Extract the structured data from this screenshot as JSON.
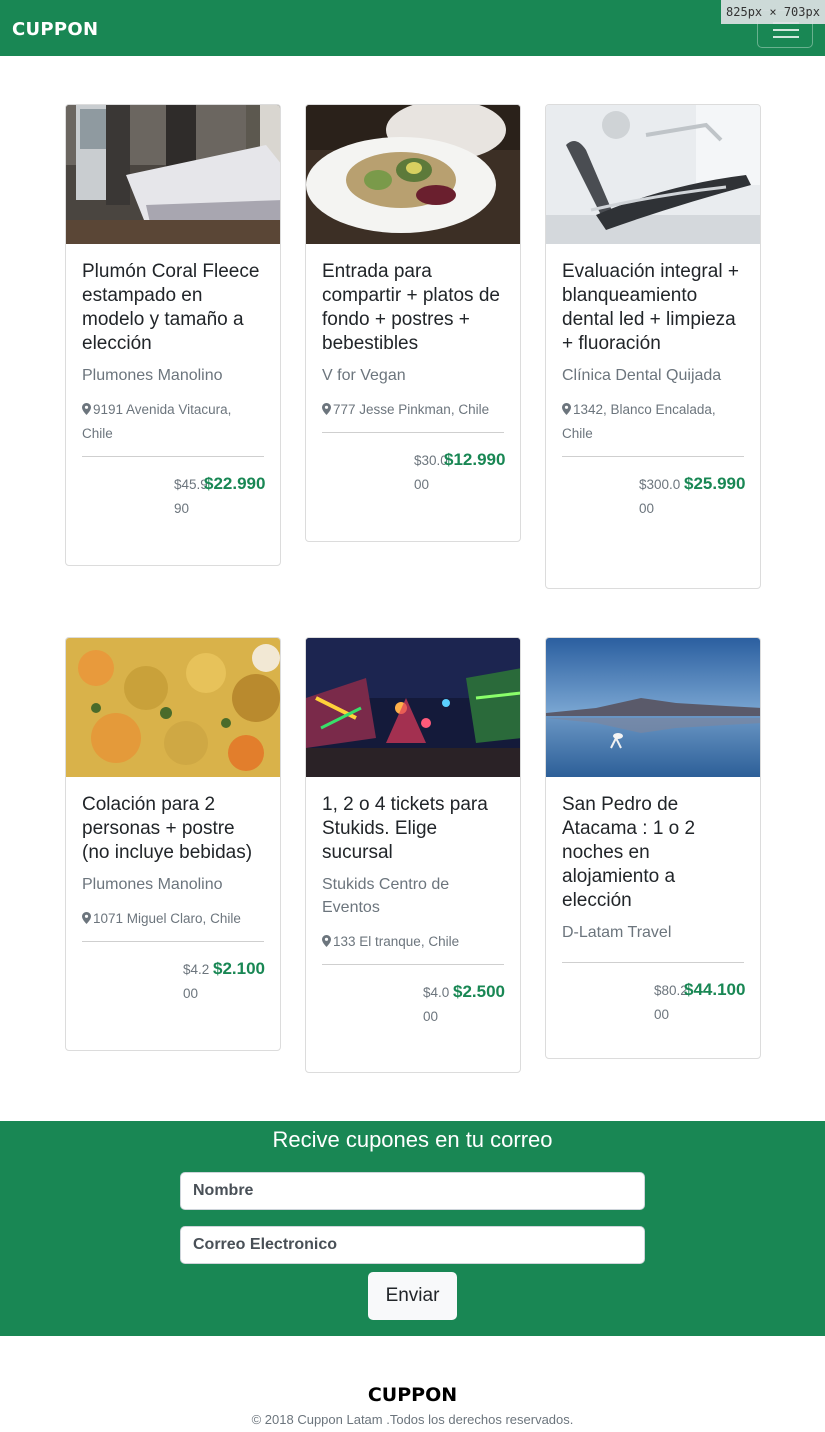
{
  "navbar": {
    "brand": "CUPPON",
    "viewport_badge": "825px × 703px",
    "menu_icon": "hamburger-icon"
  },
  "cards": [
    {
      "title": "Plumón Coral Fleece estampado en modelo y tamaño a elección",
      "vendor": "Plumones Manolino",
      "location": "9191 Avenida Vitacura, Chile",
      "old_price": "$45.990",
      "new_price": "$22.990",
      "image": "bedroom-photo"
    },
    {
      "title": "Entrada para compartir + platos de fondo + postres + bebestibles",
      "vendor": "V for Vegan",
      "location": "777 Jesse Pinkman, Chile",
      "old_price": "$30.000",
      "new_price": "$12.990",
      "image": "vegan-plate-photo"
    },
    {
      "title": "Evaluación integral + blanqueamiento dental led + limpieza + fluoración",
      "vendor": "Clínica Dental Quijada",
      "location": "1342, Blanco Encalada, Chile",
      "old_price": "$300.000",
      "new_price": "$25.990",
      "image": "dental-chair-photo"
    },
    {
      "title": "Colación para 2 personas + postre (no incluye bebidas)",
      "vendor": "Plumones Manolino",
      "location": "1071 Miguel Claro, Chile",
      "old_price": "$4.200",
      "new_price": "$2.100",
      "image": "food-dish-photo"
    },
    {
      "title": "1, 2 o 4 tickets para Stukids. Elige sucursal",
      "vendor": "Stukids Centro de Eventos",
      "location": "133 El tranque, Chile",
      "old_price": "$4.000",
      "new_price": "$2.500",
      "image": "fairground-photo"
    },
    {
      "title": "San Pedro de Atacama : 1 o 2 noches en alojamiento a elección",
      "vendor": "D-Latam Travel",
      "location": "",
      "old_price": "$80.200",
      "new_price": "$44.100",
      "image": "atacama-lake-photo"
    }
  ],
  "newsletter": {
    "title": "Recive cupones en tu correo",
    "name_placeholder": "Nombre",
    "email_placeholder": "Correo Electronico",
    "submit_label": "Enviar"
  },
  "footer": {
    "brand": "CUPPON",
    "copyright": "© 2018 Cuppon Latam .Todos los derechos reservados."
  },
  "colors": {
    "brand_green": "#198754",
    "price_green": "#198754"
  }
}
